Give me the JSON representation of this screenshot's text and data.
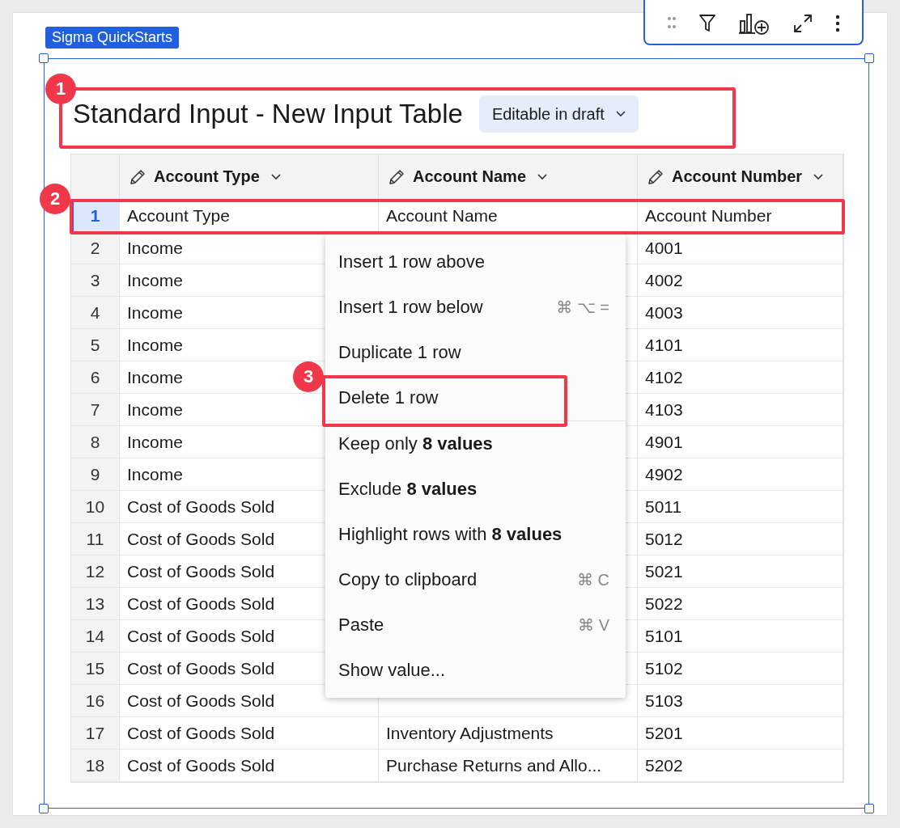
{
  "element_tag": "Sigma QuickStarts",
  "toolbar": [
    {
      "kind": "drag"
    },
    {
      "kind": "filter"
    },
    {
      "kind": "add-chart"
    },
    {
      "kind": "expand"
    },
    {
      "kind": "more"
    }
  ],
  "title": "Standard Input - New Input Table",
  "mode_badge": "Editable in draft",
  "table": {
    "columns": [
      "Account Type",
      "Account Name",
      "Account Number"
    ],
    "rows": [
      {
        "index": "1",
        "selected": true,
        "cells": [
          "Account Type",
          "Account Name",
          "Account Number"
        ]
      },
      {
        "index": "2",
        "selected": false,
        "cells": [
          "Income",
          "",
          "4001"
        ]
      },
      {
        "index": "3",
        "selected": false,
        "cells": [
          "Income",
          "",
          "4002"
        ]
      },
      {
        "index": "4",
        "selected": false,
        "cells": [
          "Income",
          "",
          "4003"
        ]
      },
      {
        "index": "5",
        "selected": false,
        "cells": [
          "Income",
          "",
          "4101"
        ]
      },
      {
        "index": "6",
        "selected": false,
        "cells": [
          "Income",
          "",
          "4102"
        ]
      },
      {
        "index": "7",
        "selected": false,
        "cells": [
          "Income",
          "",
          "4103"
        ]
      },
      {
        "index": "8",
        "selected": false,
        "cells": [
          "Income",
          "",
          "4901"
        ]
      },
      {
        "index": "9",
        "selected": false,
        "cells": [
          "Income",
          "",
          "4902"
        ]
      },
      {
        "index": "10",
        "selected": false,
        "cells": [
          "Cost of Goods Sold",
          "",
          "5011"
        ]
      },
      {
        "index": "11",
        "selected": false,
        "cells": [
          "Cost of Goods Sold",
          "",
          "5012"
        ]
      },
      {
        "index": "12",
        "selected": false,
        "cells": [
          "Cost of Goods Sold",
          "",
          "5021"
        ]
      },
      {
        "index": "13",
        "selected": false,
        "cells": [
          "Cost of Goods Sold",
          "",
          "5022"
        ]
      },
      {
        "index": "14",
        "selected": false,
        "cells": [
          "Cost of Goods Sold",
          "",
          "5101"
        ]
      },
      {
        "index": "15",
        "selected": false,
        "cells": [
          "Cost of Goods Sold",
          "",
          "5102"
        ]
      },
      {
        "index": "16",
        "selected": false,
        "cells": [
          "Cost of Goods Sold",
          "",
          "5103"
        ]
      },
      {
        "index": "17",
        "selected": false,
        "cells": [
          "Cost of Goods Sold",
          "Inventory Adjustments",
          "5201"
        ]
      },
      {
        "index": "18",
        "selected": false,
        "cells": [
          "Cost of Goods Sold",
          "Purchase Returns and Allo...",
          "5202"
        ]
      }
    ]
  },
  "context_menu": {
    "groups": [
      [
        {
          "label": "Insert 1 row above"
        },
        {
          "label": "Insert 1 row below",
          "shortcut": "⌘ ⌥ ="
        },
        {
          "label": "Duplicate 1 row"
        },
        {
          "label": "Delete 1 row"
        }
      ],
      [
        {
          "label": "Keep only **8 values**"
        },
        {
          "label": "Exclude **8 values**"
        },
        {
          "label": "Highlight rows with **8 values**"
        },
        {
          "label": "Copy to clipboard",
          "shortcut": "⌘ C"
        },
        {
          "label": "Paste",
          "shortcut": "⌘ V"
        },
        {
          "label": "Show value..."
        }
      ]
    ]
  },
  "annotations": [
    {
      "number": "1"
    },
    {
      "number": "2"
    },
    {
      "number": "3"
    }
  ]
}
